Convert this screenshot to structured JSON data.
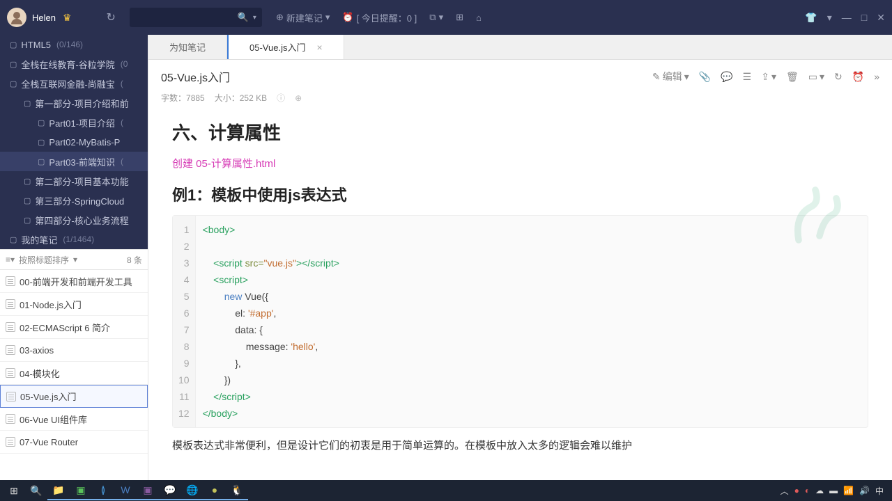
{
  "header": {
    "username": "Helen",
    "new_note": "新建笔记",
    "reminder": "[ 今日提醒：0 ]"
  },
  "tree": [
    {
      "label": "HTML5",
      "count": "(0/146)",
      "level": 0
    },
    {
      "label": "全栈在线教育-谷粒学院",
      "count": "(0",
      "level": 0
    },
    {
      "label": "全栈互联网金融-尚融宝",
      "count": "(",
      "level": 0
    },
    {
      "label": "第一部分-项目介绍和前",
      "count": "",
      "level": 1
    },
    {
      "label": "Part01-项目介绍",
      "count": "(",
      "level": 2
    },
    {
      "label": "Part02-MyBatis-P",
      "count": "",
      "level": 2
    },
    {
      "label": "Part03-前端知识",
      "count": "(",
      "level": 2,
      "selected": true
    },
    {
      "label": "第二部分-项目基本功能",
      "count": "",
      "level": 1
    },
    {
      "label": "第三部分-SpringCloud",
      "count": "",
      "level": 1
    },
    {
      "label": "第四部分-核心业务流程",
      "count": "",
      "level": 1
    },
    {
      "label": "我的笔记",
      "count": "(1/1464)",
      "level": 0
    }
  ],
  "sort": {
    "label": "按照标题排序",
    "count": "8 条"
  },
  "notes": [
    {
      "title": "00-前端开发和前端开发工具"
    },
    {
      "title": "01-Node.js入门"
    },
    {
      "title": "02-ECMAScript 6 简介"
    },
    {
      "title": "03-axios"
    },
    {
      "title": "04-模块化"
    },
    {
      "title": "05-Vue.js入门",
      "selected": true
    },
    {
      "title": "06-Vue UI组件库"
    },
    {
      "title": "07-Vue Router"
    }
  ],
  "tabs": [
    {
      "label": "为知笔记",
      "active": false
    },
    {
      "label": "05-Vue.js入门",
      "active": true,
      "closable": true
    }
  ],
  "doc": {
    "title": "05-Vue.js入门",
    "word_count_label": "字数：",
    "word_count": "7885",
    "size_label": "大小：",
    "size": "252 KB",
    "edit_label": "编辑",
    "h1": "六、计算属性",
    "link_text": "创建 05-计算属性.html",
    "h2": "例1：模板中使用js表达式",
    "para": "模板表达式非常便利，但是设计它们的初衷是用于简单运算的。在模板中放入太多的逻辑会难以维护",
    "code_lines": 12,
    "code": {
      "l1": {
        "a": "<body>"
      },
      "l3": {
        "a": "    <script ",
        "b": "src=",
        "c": "\"vue.js\"",
        "d": "></",
        "e": "script",
        "f": ">"
      },
      "l4": {
        "a": "    <script>"
      },
      "l5": {
        "a": "        ",
        "b": "new",
        "c": " Vue({"
      },
      "l6": {
        "a": "            el: ",
        "b": "'#app'",
        "c": ","
      },
      "l7": {
        "a": "            data: {"
      },
      "l8": {
        "a": "                message: ",
        "b": "'hello'",
        "c": ","
      },
      "l9": {
        "a": "            },"
      },
      "l10": {
        "a": "        })"
      },
      "l11": {
        "a": "    </",
        "b": "script",
        "c": ">"
      },
      "l12": {
        "a": "</body>"
      }
    }
  },
  "taskbar": {
    "ime": "中"
  }
}
